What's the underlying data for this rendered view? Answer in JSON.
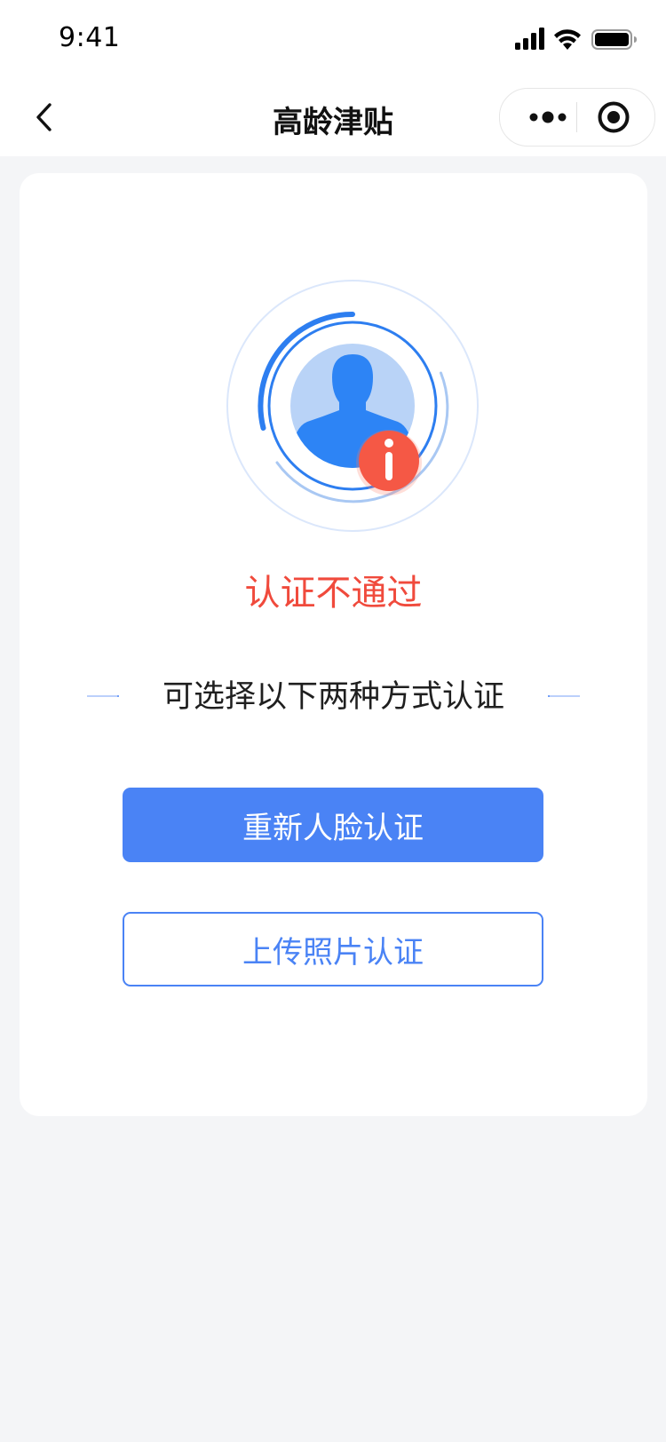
{
  "status_bar": {
    "time": "9:41",
    "icons": [
      "signal-icon",
      "wifi-icon",
      "battery-icon"
    ]
  },
  "nav": {
    "title": "高龄津贴",
    "back_icon": "chevron-left-icon",
    "more_icon": "more-dots-icon",
    "close_icon": "target-close-icon"
  },
  "result": {
    "status_text": "认证不通过",
    "icon": "avatar-warning-icon"
  },
  "options": {
    "prompt": "可选择以下两种方式认证",
    "primary_label": "重新人脸认证",
    "secondary_label": "上传照片认证"
  },
  "colors": {
    "accent": "#4a83f5",
    "error": "#f04a3c",
    "avatar": "#2d84f5",
    "background": "#f4f5f7"
  }
}
